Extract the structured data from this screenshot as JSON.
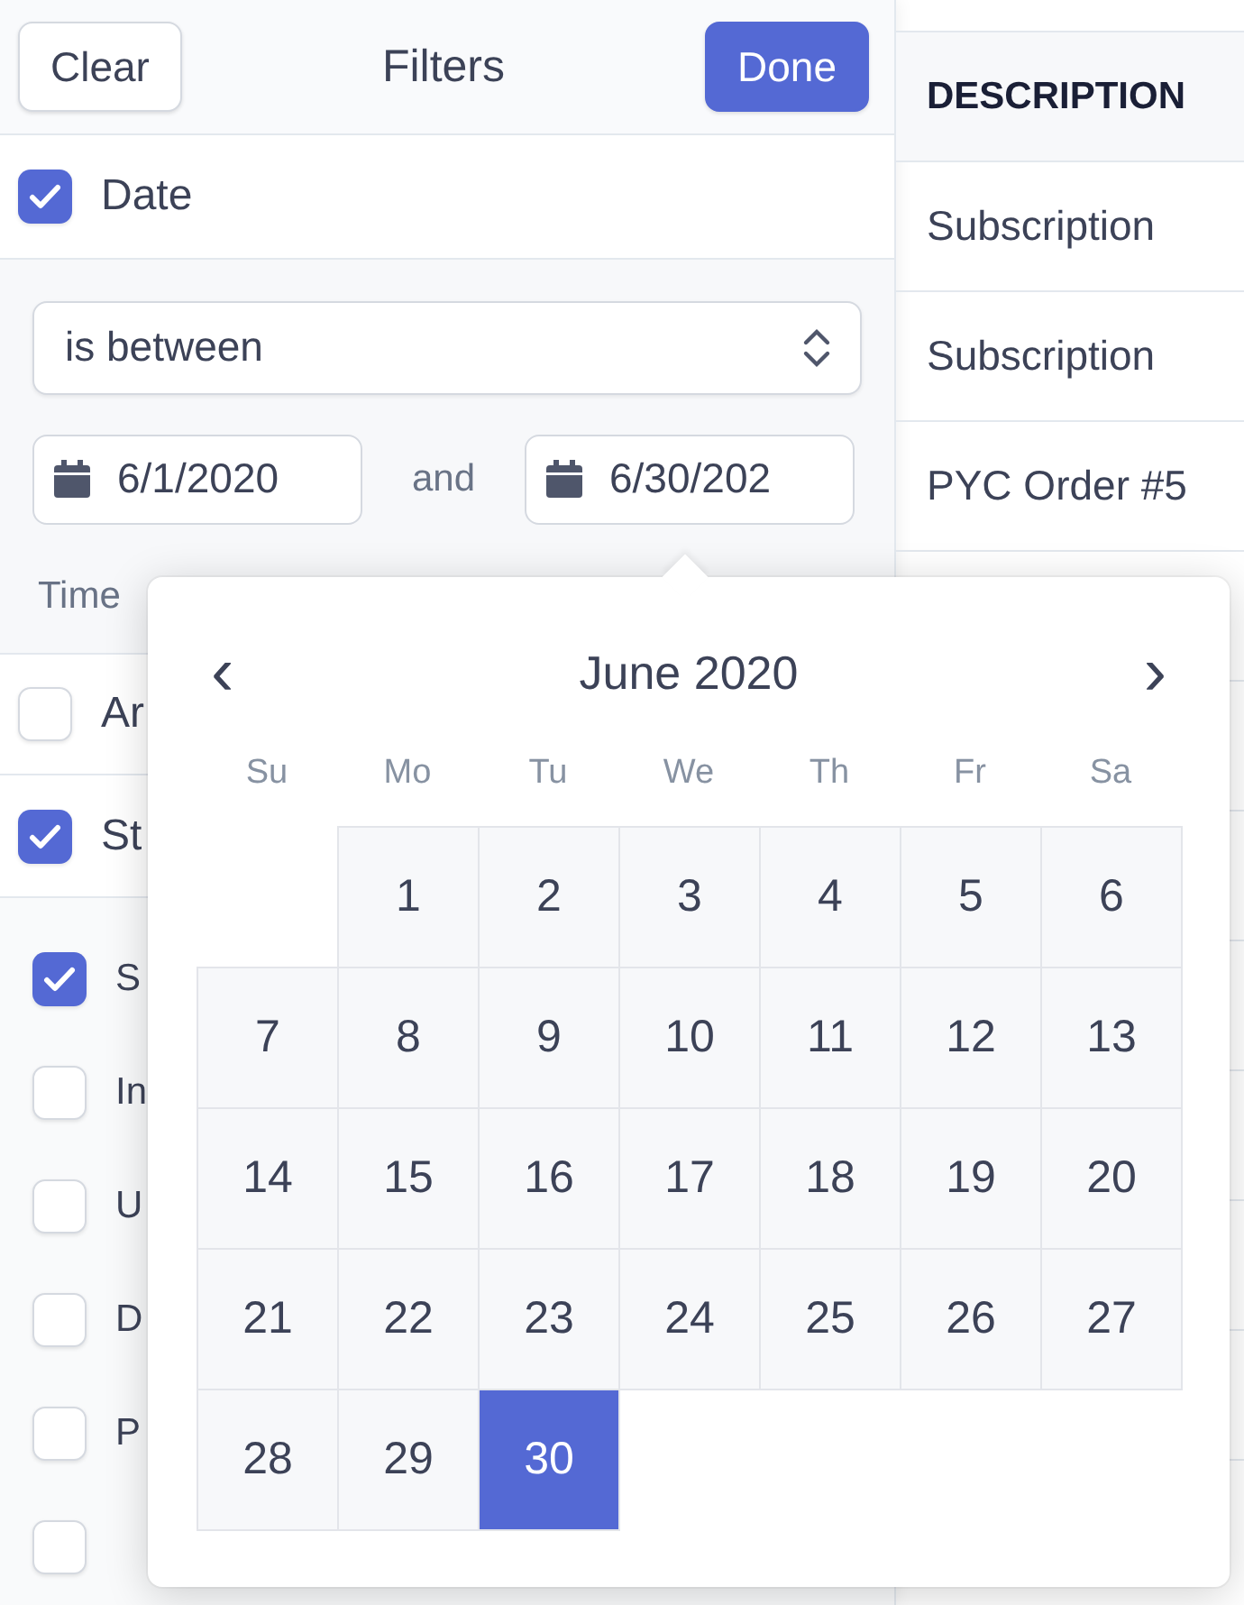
{
  "filters": {
    "clear_button": "Clear",
    "title": "Filters",
    "done_button": "Done",
    "date": {
      "label": "Date",
      "checked": true,
      "operator": "is between",
      "start": "6/1/2020",
      "joiner": "and",
      "end": "6/30/202",
      "time_label": "Time"
    },
    "sections": [
      {
        "label": "Ar",
        "checked": false
      },
      {
        "label": "St",
        "checked": true
      }
    ],
    "status_options": [
      {
        "label": "S",
        "checked": true
      },
      {
        "label": "In",
        "checked": false
      },
      {
        "label": "U",
        "checked": false
      },
      {
        "label": "D",
        "checked": false
      },
      {
        "label": "P",
        "checked": false
      },
      {
        "checked": false
      }
    ]
  },
  "table": {
    "columns": [
      "DESCRIPTION"
    ],
    "rows": [
      "Subscription",
      "Subscription",
      "PYC Order #5"
    ]
  },
  "calendar": {
    "month": "June 2020",
    "prev": "‹",
    "next": "›",
    "weekdays": [
      "Su",
      "Mo",
      "Tu",
      "We",
      "Th",
      "Fr",
      "Sa"
    ],
    "days": [
      {
        "kind": "blank"
      },
      {
        "kind": "day",
        "label": "1",
        "selected": false
      },
      {
        "kind": "day",
        "label": "2",
        "selected": false
      },
      {
        "kind": "day",
        "label": "3",
        "selected": false
      },
      {
        "kind": "day",
        "label": "4",
        "selected": false
      },
      {
        "kind": "day",
        "label": "5",
        "selected": false
      },
      {
        "kind": "day",
        "label": "6",
        "selected": false
      },
      {
        "kind": "day",
        "label": "7",
        "selected": false
      },
      {
        "kind": "day",
        "label": "8",
        "selected": false
      },
      {
        "kind": "day",
        "label": "9",
        "selected": false
      },
      {
        "kind": "day",
        "label": "10",
        "selected": false
      },
      {
        "kind": "day",
        "label": "11",
        "selected": false
      },
      {
        "kind": "day",
        "label": "12",
        "selected": false
      },
      {
        "kind": "day",
        "label": "13",
        "selected": false
      },
      {
        "kind": "day",
        "label": "14",
        "selected": false
      },
      {
        "kind": "day",
        "label": "15",
        "selected": false
      },
      {
        "kind": "day",
        "label": "16",
        "selected": false
      },
      {
        "kind": "day",
        "label": "17",
        "selected": false
      },
      {
        "kind": "day",
        "label": "18",
        "selected": false
      },
      {
        "kind": "day",
        "label": "19",
        "selected": false
      },
      {
        "kind": "day",
        "label": "20",
        "selected": false
      },
      {
        "kind": "day",
        "label": "21",
        "selected": false
      },
      {
        "kind": "day",
        "label": "22",
        "selected": false
      },
      {
        "kind": "day",
        "label": "23",
        "selected": false
      },
      {
        "kind": "day",
        "label": "24",
        "selected": false
      },
      {
        "kind": "day",
        "label": "25",
        "selected": false
      },
      {
        "kind": "day",
        "label": "26",
        "selected": false
      },
      {
        "kind": "day",
        "label": "27",
        "selected": false
      },
      {
        "kind": "day",
        "label": "28",
        "selected": false
      },
      {
        "kind": "day",
        "label": "29",
        "selected": false
      },
      {
        "kind": "day",
        "label": "30",
        "selected": true
      }
    ]
  }
}
